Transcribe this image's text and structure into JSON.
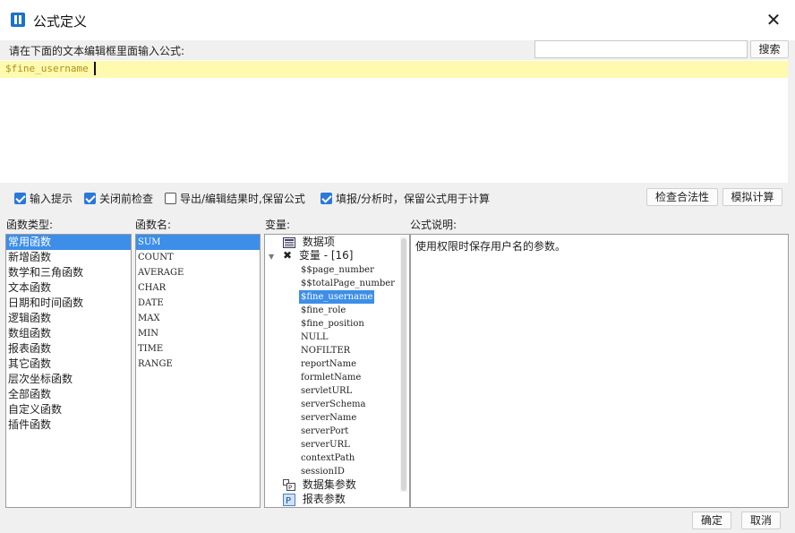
{
  "window": {
    "title": "公式定义",
    "close_label": "✕"
  },
  "editor": {
    "prompt": "请在下面的文本编辑框里面输入公式:",
    "formula": "$fine_username",
    "search_value": "",
    "search_button": "搜索"
  },
  "options": {
    "checkboxes": [
      {
        "label": "输入提示",
        "checked": true
      },
      {
        "label": "关闭前检查",
        "checked": true
      },
      {
        "label": "导出/编辑结果时,保留公式",
        "checked": false
      },
      {
        "label": "填报/分析时，保留公式用于计算",
        "checked": true
      }
    ],
    "check_button": "检查合法性",
    "simulate_button": "模拟计算"
  },
  "labels": {
    "func_types": "函数类型:",
    "func_names": "函数名:",
    "variables": "变量:",
    "description": "公式说明:"
  },
  "func_types": [
    "常用函数",
    "新增函数",
    "数学和三角函数",
    "文本函数",
    "日期和时间函数",
    "逻辑函数",
    "数组函数",
    "报表函数",
    "其它函数",
    "层次坐标函数",
    "全部函数",
    "自定义函数",
    "插件函数"
  ],
  "func_names": [
    "SUM",
    "COUNT",
    "AVERAGE",
    "CHAR",
    "DATE",
    "MAX",
    "MIN",
    "TIME",
    "RANGE"
  ],
  "variables": {
    "data_item": "数据项",
    "var_group": "变量 - [16]",
    "items": [
      "$$page_number",
      "$$totalPage_number",
      "$fine_username",
      "$fine_role",
      "$fine_position",
      "NULL",
      "NOFILTER",
      "reportName",
      "formletName",
      "servletURL",
      "serverSchema",
      "serverName",
      "serverPort",
      "serverURL",
      "contextPath",
      "sessionID"
    ],
    "dataset_params": "数据集参数",
    "report_params": "报表参数"
  },
  "description_text": "使用权限时保存用户名的参数。",
  "footer": {
    "ok": "确定",
    "cancel": "取消"
  },
  "colors": {
    "accent": "#3d8ee8",
    "editor_highlight": "#fffaaf",
    "formula_text": "#b08f1a"
  }
}
